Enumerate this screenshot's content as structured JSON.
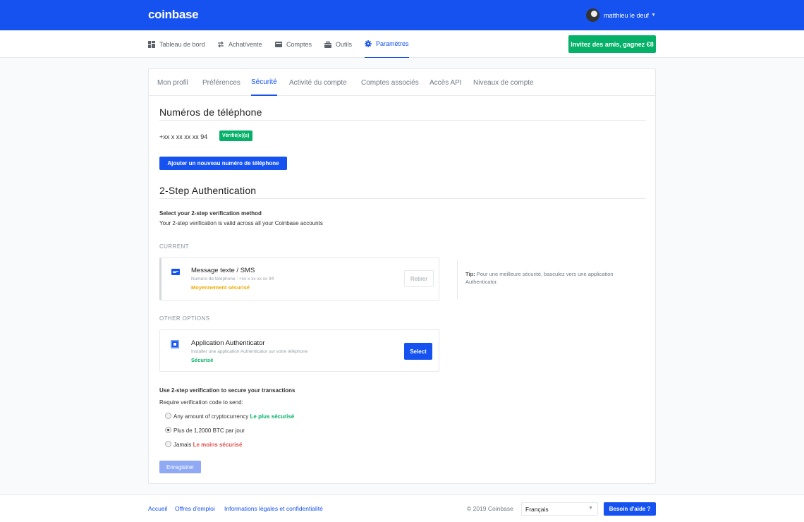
{
  "app": {
    "logo": "coinbase",
    "user_name": "matthieu le deuf"
  },
  "nav": {
    "items": [
      {
        "label": "Tableau de bord",
        "icon": "dashboard-icon"
      },
      {
        "label": "Achat/vente",
        "icon": "swap-icon"
      },
      {
        "label": "Comptes",
        "icon": "wallet-icon"
      },
      {
        "label": "Outils",
        "icon": "toolbox-icon"
      },
      {
        "label": "Paramètres",
        "icon": "gear-icon",
        "active": true
      }
    ],
    "invite_label": "Invitez des amis, gagnez €8"
  },
  "tabs": [
    {
      "label": "Mon profil"
    },
    {
      "label": "Préférences"
    },
    {
      "label": "Sécurité",
      "active": true
    },
    {
      "label": "Activité du compte"
    },
    {
      "label": "Comptes associés"
    },
    {
      "label": "Accès API"
    },
    {
      "label": "Niveaux de compte"
    }
  ],
  "phones": {
    "title": "Numéros de téléphone",
    "number": "+xx x xx xx xx 94",
    "verified_badge": "Vérifié(e)(s)",
    "add_button": "Ajouter un nouveau numéro de téléphone"
  },
  "two_step": {
    "title": "2-Step Authentication",
    "select_heading": "Select your 2-step verification method",
    "select_desc": "Your 2-step verification is valid across all your Coinbase accounts",
    "current_label": "CURRENT",
    "current": {
      "title": "Message texte / SMS",
      "subtitle": "Numéro de téléphone : +xx x xx xx xx 94",
      "security": "Moyennement sécurisé",
      "button": "Retirer"
    },
    "tip_label": "Tip:",
    "tip_text": "Pour une meilleure sécurité, basculez vers une application Authenticator.",
    "other_label": "OTHER OPTIONS",
    "other": {
      "title": "Application Authenticator",
      "subtitle": "Installer une application Authenticator sur votre téléphone",
      "security": "Sécurisé",
      "button": "Select"
    }
  },
  "transactions": {
    "heading": "Use 2-step verification to secure your transactions",
    "desc": "Require verification code to send:",
    "options": [
      {
        "label": "Any amount of cryptocurrency",
        "tag": "Le plus sécurisé",
        "checked": false
      },
      {
        "label": "Plus de 1,2000 BTC par jour",
        "tag": "",
        "checked": true
      },
      {
        "label": "Jamais",
        "tag": "Le moins sécurisé",
        "checked": false
      }
    ],
    "save_button": "Enregistrer"
  },
  "footer": {
    "links": [
      "Accueil",
      "Offres d'emploi",
      "Informations légales et confidentialité"
    ],
    "copyright": "© 2019 Coinbase",
    "language": "Français",
    "help_button": "Besoin d'aide ?"
  },
  "colors": {
    "brand": "#1652f0",
    "success": "#05b169",
    "warning": "#f2a900",
    "danger": "#e04e4e"
  }
}
